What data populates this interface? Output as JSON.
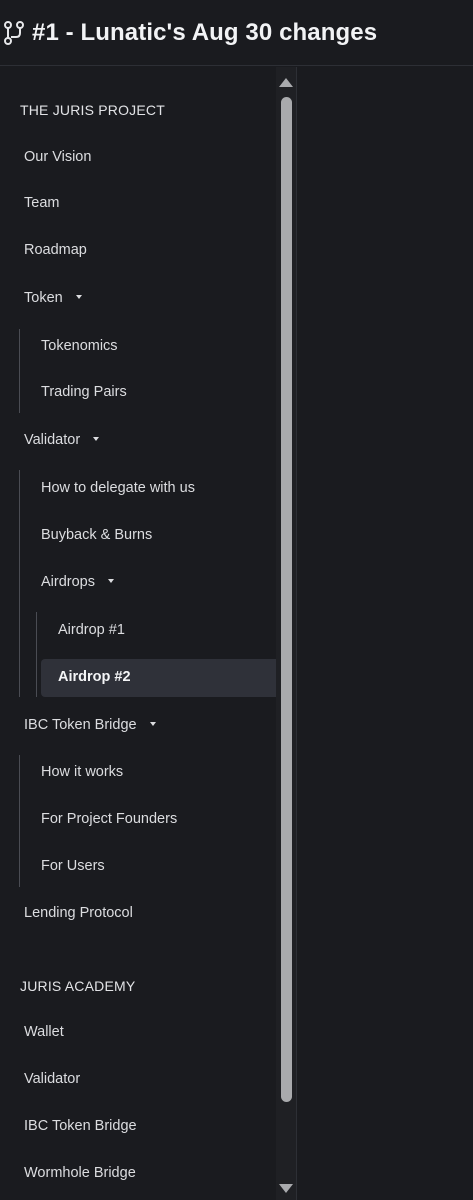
{
  "header": {
    "title": "#1 - Lunatic's Aug 30 changes"
  },
  "sidebar": {
    "section1_title": "THE JURIS PROJECT",
    "our_vision": "Our Vision",
    "team": "Team",
    "roadmap": "Roadmap",
    "token": "Token",
    "tokenomics": "Tokenomics",
    "trading_pairs": "Trading Pairs",
    "validator": "Validator",
    "how_to_delegate": "How to delegate with us",
    "buyback_burns": "Buyback & Burns",
    "airdrops": "Airdrops",
    "airdrop1": "Airdrop #1",
    "airdrop2": "Airdrop #2",
    "ibc_bridge": "IBC Token Bridge",
    "how_it_works": "How it works",
    "for_project_founders": "For Project Founders",
    "for_users": "For Users",
    "lending_protocol": "Lending Protocol",
    "section2_title": "JURIS ACADEMY",
    "academy_wallet": "Wallet",
    "academy_validator": "Validator",
    "academy_ibc": "IBC Token Bridge",
    "academy_wormhole": "Wormhole Bridge"
  },
  "colors": {
    "background": "#1a1b1f",
    "active_item_bg": "#2f3139",
    "scrollbar_thumb": "#a9aaad"
  },
  "icons": {
    "title_icon": "git-branch-icon"
  }
}
